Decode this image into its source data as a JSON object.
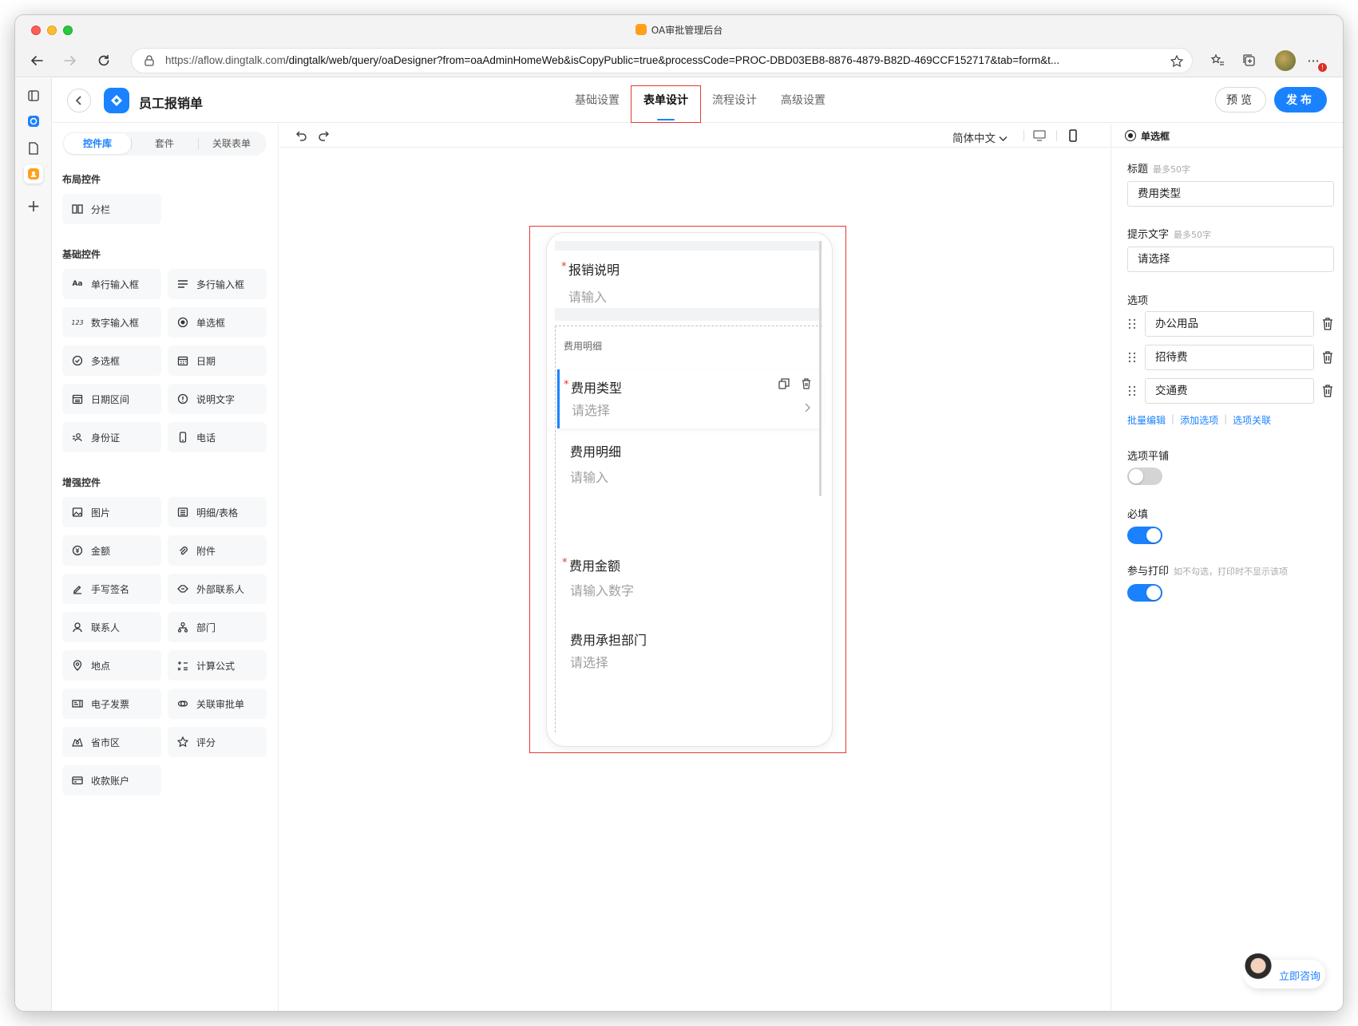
{
  "browser": {
    "window_title": "OA审批管理后台",
    "url_host": "https://aflow.dingtalk.com",
    "url_path": "/dingtalk/web/query/oaDesigner?from=oaAdminHomeWeb&isCopyPublic=true&processCode=PROC-DBD03EB8-8876-4879-B82D-469CCF152717&tab=form&t..."
  },
  "header": {
    "app_name": "员工报销单",
    "tabs": [
      {
        "label": "基础设置",
        "active": false
      },
      {
        "label": "表单设计",
        "active": true
      },
      {
        "label": "流程设计",
        "active": false
      },
      {
        "label": "高级设置",
        "active": false
      }
    ],
    "preview_label": "预览",
    "publish_label": "发布"
  },
  "sidebar": {
    "segments": [
      "控件库",
      "套件",
      "关联表单"
    ],
    "groups": [
      {
        "title": "布局控件",
        "items": [
          {
            "label": "分栏",
            "icon": "columns-icon"
          }
        ]
      },
      {
        "title": "基础控件",
        "items": [
          {
            "label": "单行输入框",
            "icon": "text-aa-icon"
          },
          {
            "label": "多行输入框",
            "icon": "multiline-icon"
          },
          {
            "label": "数字输入框",
            "icon": "number-123-icon"
          },
          {
            "label": "单选框",
            "icon": "radio-icon"
          },
          {
            "label": "多选框",
            "icon": "checkbox-icon"
          },
          {
            "label": "日期",
            "icon": "calendar-icon"
          },
          {
            "label": "日期区间",
            "icon": "date-range-icon"
          },
          {
            "label": "说明文字",
            "icon": "info-icon"
          },
          {
            "label": "身份证",
            "icon": "id-card-icon"
          },
          {
            "label": "电话",
            "icon": "phone-icon"
          }
        ]
      },
      {
        "title": "增强控件",
        "items": [
          {
            "label": "图片",
            "icon": "image-icon"
          },
          {
            "label": "明细/表格",
            "icon": "table-icon"
          },
          {
            "label": "金额",
            "icon": "money-icon"
          },
          {
            "label": "附件",
            "icon": "attachment-icon"
          },
          {
            "label": "手写签名",
            "icon": "signature-icon"
          },
          {
            "label": "外部联系人",
            "icon": "external-contact-icon"
          },
          {
            "label": "联系人",
            "icon": "contact-icon"
          },
          {
            "label": "部门",
            "icon": "department-icon"
          },
          {
            "label": "地点",
            "icon": "location-icon"
          },
          {
            "label": "计算公式",
            "icon": "formula-icon"
          },
          {
            "label": "电子发票",
            "icon": "invoice-icon"
          },
          {
            "label": "关联审批单",
            "icon": "link-approval-icon"
          },
          {
            "label": "省市区",
            "icon": "region-icon"
          },
          {
            "label": "评分",
            "icon": "star-icon"
          },
          {
            "label": "收款账户",
            "icon": "bank-account-icon"
          }
        ]
      }
    ]
  },
  "canvas": {
    "language": "简体中文",
    "form": {
      "field1": {
        "label": "报销说明",
        "placeholder": "请输入",
        "required": true
      },
      "detail_title": "费用明细",
      "field2": {
        "label": "费用类型",
        "placeholder": "请选择",
        "required": true
      },
      "field3": {
        "label": "费用明细",
        "placeholder": "请输入",
        "required": false
      },
      "field4": {
        "label": "费用金额",
        "placeholder": "请输入数字",
        "required": true
      },
      "field5": {
        "label": "费用承担部门",
        "placeholder": "请选择",
        "required": false
      }
    }
  },
  "props": {
    "control_type": "单选框",
    "title_label": "标题",
    "title_hint": "最多50字",
    "title_value": "费用类型",
    "placeholder_label": "提示文字",
    "placeholder_hint": "最多50字",
    "placeholder_value": "请选择",
    "options_label": "选项",
    "options": [
      "办公用品",
      "招待费",
      "交通费"
    ],
    "links": [
      "批量编辑",
      "添加选项",
      "选项关联"
    ],
    "tile_label": "选项平铺",
    "tile_on": false,
    "required_label": "必填",
    "required_on": true,
    "print_label": "参与打印",
    "print_hint": "如不勾选，打印时不显示该项",
    "print_on": true
  },
  "consult_label": "立即咨询"
}
